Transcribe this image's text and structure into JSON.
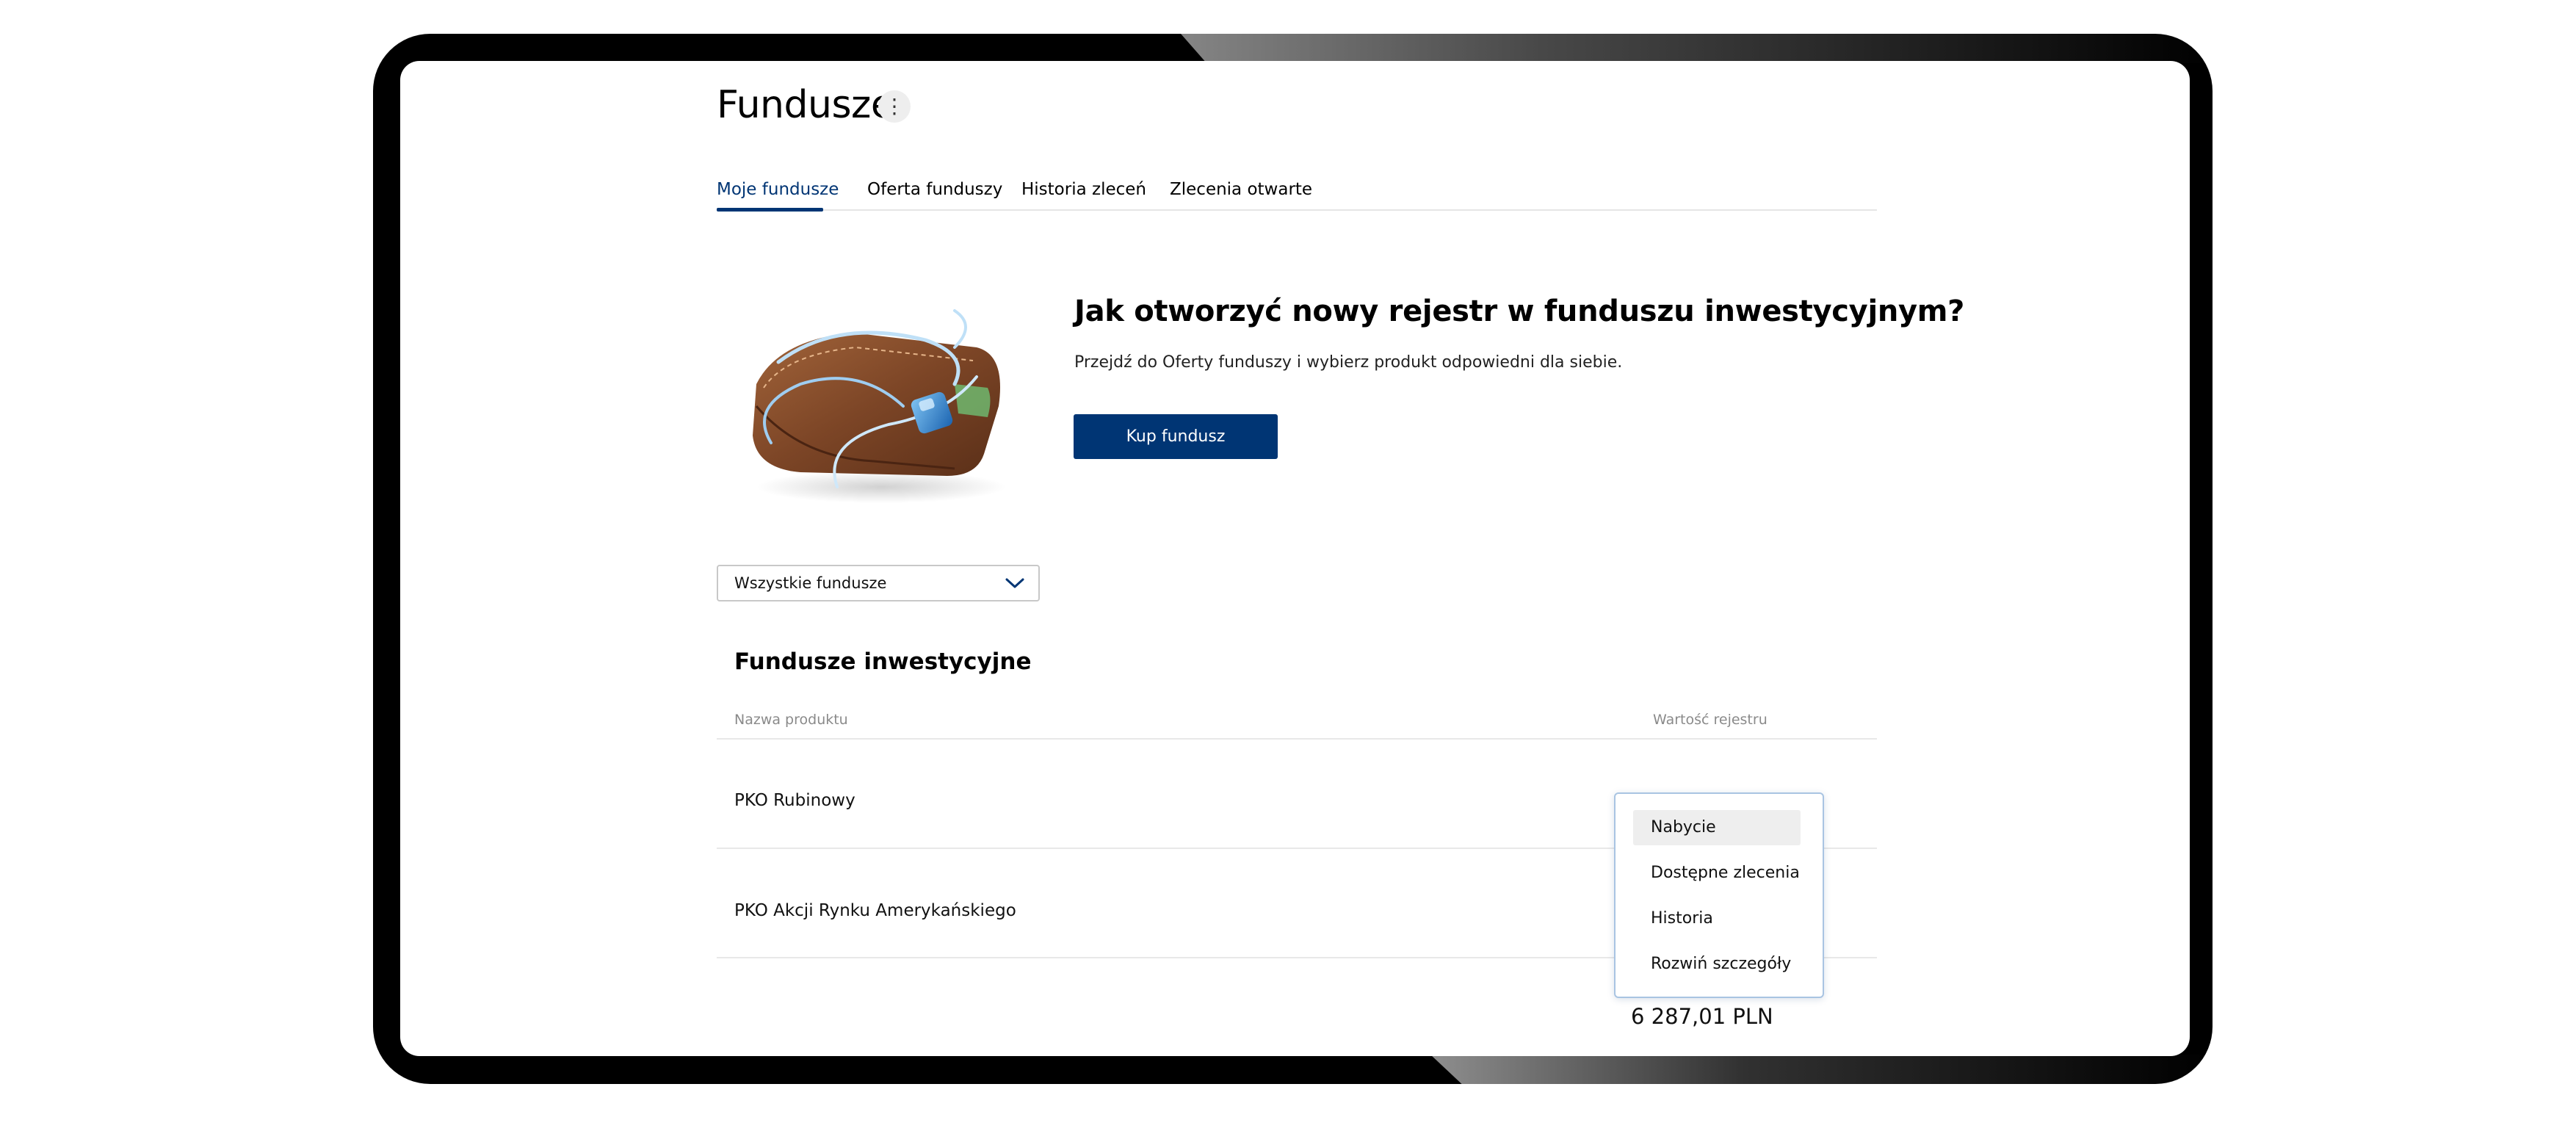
{
  "page": {
    "title": "Fundusze",
    "title_menu_icon": "⋮"
  },
  "tabs": [
    {
      "label": "Moje fundusze",
      "active": true
    },
    {
      "label": "Oferta funduszy",
      "active": false
    },
    {
      "label": "Historia zleceń",
      "active": false
    },
    {
      "label": "Zlecenia otwarte",
      "active": false
    }
  ],
  "promo": {
    "illustration": "wallet-illustration",
    "title": "Jak otworzyć nowy rejestr w funduszu inwestycyjnym?",
    "text": "Przejdź do Oferty funduszy i wybierz produkt odpowiedni dla siebie.",
    "button_label": "Kup fundusz"
  },
  "filter": {
    "selected": "Wszystkie fundusze"
  },
  "table": {
    "section_title": "Fundusze inwestycyjne",
    "columns": [
      "Nazwa produktu",
      "Wartość rejestru"
    ],
    "rows": [
      {
        "name": "PKO Rubinowy",
        "menu_icon": "⋮"
      },
      {
        "name": "PKO Akcji Rynku Amerykańskiego",
        "menu_icon": "⋮",
        "value": "6 287,01 PLN"
      }
    ]
  },
  "dropdown_menu": {
    "items": [
      {
        "label": "Nabycie",
        "highlighted": true
      },
      {
        "label": "Dostępne zlecenia",
        "highlighted": false
      },
      {
        "label": "Historia",
        "highlighted": false
      },
      {
        "label": "Rozwiń szczegóły",
        "highlighted": false
      }
    ]
  },
  "colors": {
    "brand": "#003574",
    "dropdown_border": "#a9c4e2",
    "muted_text": "#8a8a8a"
  }
}
